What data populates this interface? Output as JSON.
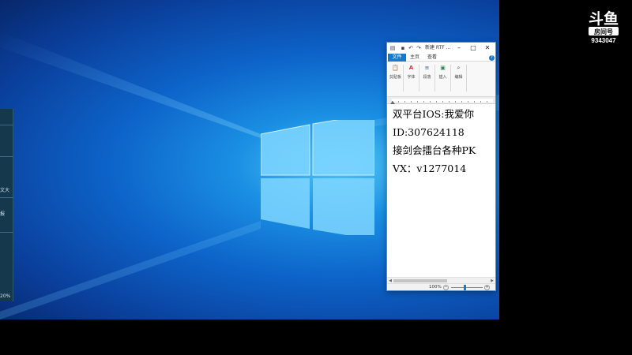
{
  "side_panel": {
    "text_1": "文大",
    "text_2": "报",
    "text_3": "20%"
  },
  "wordpad": {
    "title": "新建 RTF ...",
    "tabs": [
      "文件",
      "主页",
      "查看"
    ],
    "help": "?",
    "ribbon_groups": [
      {
        "label": "剪贴板",
        "icon": "clipboard-icon",
        "glyph": "📋"
      },
      {
        "label": "字体",
        "icon": "font-color-icon",
        "glyph": "A"
      },
      {
        "label": "段落",
        "icon": "paragraph-icon",
        "glyph": "≡"
      },
      {
        "label": "插入",
        "icon": "picture-icon",
        "glyph": "▣"
      },
      {
        "label": "编辑",
        "icon": "binoculars-icon",
        "glyph": "⌕"
      }
    ],
    "document_lines": [
      "双平台IOS:我爱你",
      "ID:307624118",
      "接剑会擂台各种PK",
      "VX：v1277014"
    ],
    "zoom": "100%",
    "zoom_minus": "−",
    "zoom_plus": "+"
  },
  "watermark": {
    "logo_text": "斗鱼",
    "logo_sub": "房间号",
    "room_number": "9343047"
  },
  "colors": {
    "accent": "#1979ca",
    "desktop_blue": "#0d63c9"
  }
}
